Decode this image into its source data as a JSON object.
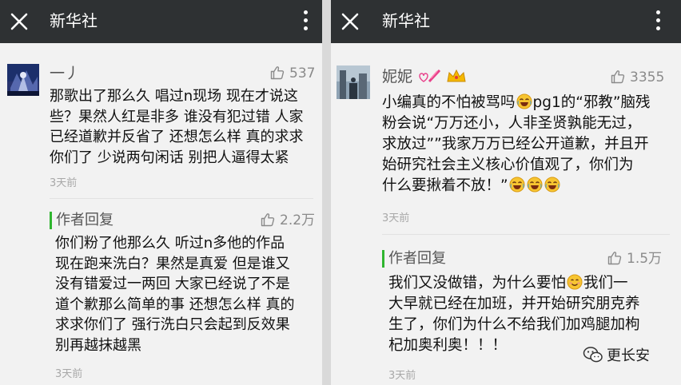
{
  "left": {
    "title": "新华社",
    "comment": {
      "user": "一丿",
      "likes": "537",
      "lines": [
        "那歌出了那么久 唱过n现场 现在才说这",
        "些？果然人红是非多 谁没有犯过错 人家",
        "已经道歉并反省了 还想怎么样 真的求求",
        "你们了 少说两句闲话 别把人逼得太紧"
      ],
      "time": "3天前"
    },
    "reply": {
      "label": "作者回复",
      "likes": "2.2万",
      "lines": [
        "你们粉了他那么久  听过n多他的作品",
        "现在跑来洗白？果然是真爱  但是谁又",
        "没有错爱过一两回  大家已经说了不是",
        "道个歉那么简单的事  还想怎么样  真的",
        "求求你们了  强行洗白只会起到反效果",
        "别再越抹越黑"
      ],
      "time": "3天前"
    }
  },
  "right": {
    "title": "新华社",
    "comment": {
      "user": "妮妮",
      "likes": "3355",
      "line1_a": "小编真的不怕被骂吗",
      "line1_b": "pg1的“邪教”脑残",
      "line2": "粉会说“万万还小，人非圣贤孰能无过，",
      "line3": "求放过””我家万万已经公开道歉，并且开",
      "line4": "始研究社会主义核心价值观了，你们为",
      "line5": "什么要揪着不放！”",
      "time": "3天前"
    },
    "reply": {
      "label": "作者回复",
      "likes": "1.5万",
      "line1_a": "我们又没做错，为什么要怕",
      "line1_b": "我们一",
      "line2": "大早就已经在加班，并开始研究朋克养",
      "line3": "生了，你们为什么不给我们加鸡腿加枸",
      "line4": "杞加奥利奥！！！",
      "time": "3天前"
    }
  },
  "watermark": "更长安",
  "icons": {
    "close": "close-icon",
    "more": "more-vertical-icon",
    "like": "thumbs-up-icon",
    "laugh_cry": "laugh-cry-emoji",
    "smile": "smile-emoji",
    "crown": "crown-icon",
    "sticker": "heart-sticker-icon",
    "wechat": "wechat-logo-icon"
  },
  "colors": {
    "topbar": "#2e3133",
    "background": "#f2f2f2",
    "reply_accent": "#2fb52f",
    "crown": "#f5b800",
    "sticker": "#e8408a"
  }
}
